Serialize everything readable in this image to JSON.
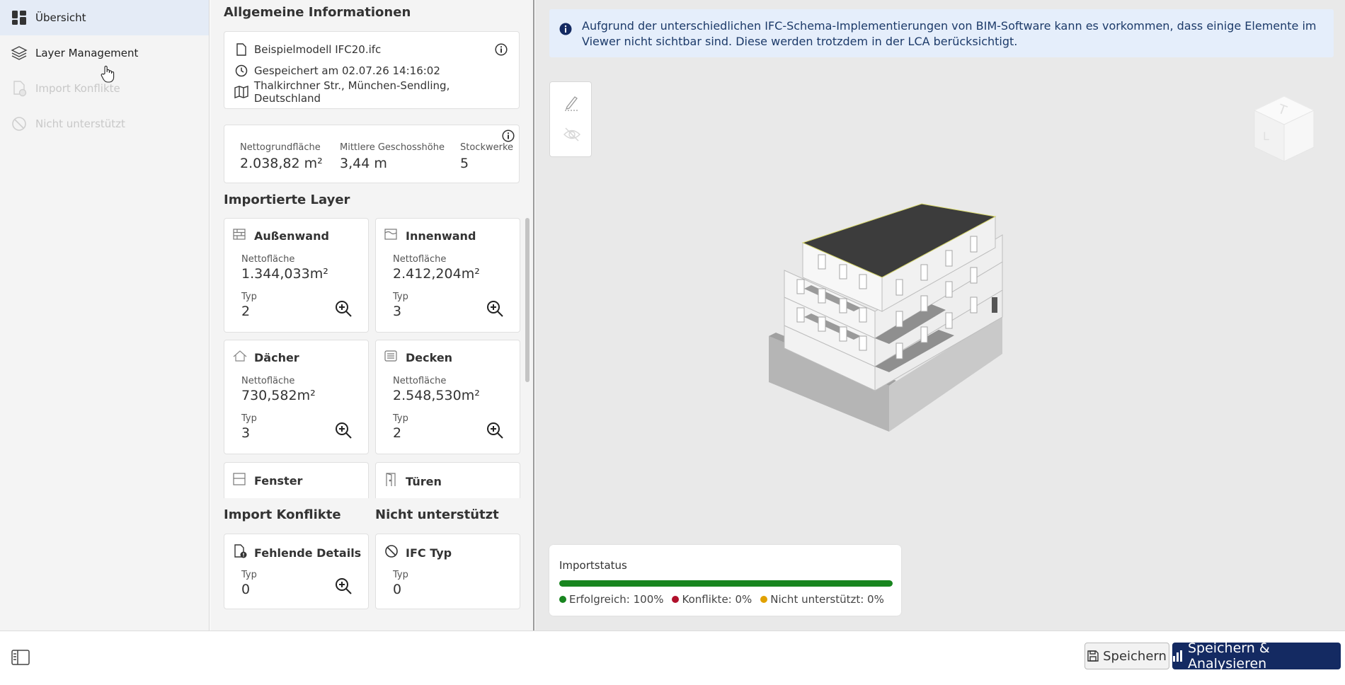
{
  "sidebar": {
    "items": [
      {
        "label": "Übersicht",
        "icon": "dashboard-icon",
        "state": "active"
      },
      {
        "label": "Layer Management",
        "icon": "layers-icon",
        "state": "normal"
      },
      {
        "label": "Import Konflikte",
        "icon": "file-conflict-icon",
        "state": "disabled"
      },
      {
        "label": "Nicht unterstützt",
        "icon": "ban-icon",
        "state": "disabled"
      }
    ]
  },
  "general": {
    "title": "Allgemeine Informationen",
    "file": "Beispielmodell IFC20.ifc",
    "saved": "Gespeichert am 02.07.26 14:16:02",
    "address": "Thalkirchner Str., München-Sendling, Deutschland"
  },
  "stats": [
    {
      "label": "Nettogrundfläche",
      "value": "2.038,82 m²"
    },
    {
      "label": "Mittlere Geschosshöhe",
      "value": "3,44 m"
    },
    {
      "label": "Stockwerke",
      "value": "5"
    }
  ],
  "layers": {
    "title": "Importierte Layer",
    "area_label": "Nettofläche",
    "type_label": "Typ",
    "items": [
      {
        "name": "Außenwand",
        "area": "1.344,033m²",
        "type": "2",
        "icon": "brick-wall-icon"
      },
      {
        "name": "Innenwand",
        "area": "2.412,204m²",
        "type": "3",
        "icon": "inner-wall-icon"
      },
      {
        "name": "Dächer",
        "area": "730,582m²",
        "type": "3",
        "icon": "roof-icon"
      },
      {
        "name": "Decken",
        "area": "2.548,530m²",
        "type": "2",
        "icon": "slab-icon"
      },
      {
        "name": "Fenster",
        "icon": "window-icon"
      },
      {
        "name": "Türen",
        "icon": "door-icon"
      }
    ]
  },
  "conflicts": {
    "title": "Import Konflikte",
    "card_name": "Fehlende Details",
    "type_label": "Typ",
    "type_value": "0"
  },
  "unsupported": {
    "title": "Nicht unterstützt",
    "card_name": "IFC Typ",
    "type_label": "Typ",
    "type_value": "0"
  },
  "viewer": {
    "banner": "Aufgrund der unterschiedlichen IFC-Schema-Implementierungen von BIM-Software kann es vorkommen, dass einige Elemente im Viewer nicht sichtbar sind. Diese werden trotzdem in der LCA berücksichtigt."
  },
  "import_status": {
    "title": "Importstatus",
    "progress_fraction": 1.0,
    "legend": [
      {
        "label": "Erfolgreich: 100%",
        "color": "#18851f"
      },
      {
        "label": "Konflikte: 0%",
        "color": "#b0102b"
      },
      {
        "label": "Nicht unterstützt: 0%",
        "color": "#e1a100"
      }
    ]
  },
  "footer": {
    "save_label": "Speichern",
    "analyse_label": "Speichern & Analysieren"
  },
  "colors": {
    "accent_dark": "#142a62",
    "active_bg": "#e4ebf6",
    "banner_bg": "#e5eefb",
    "success": "#18851f"
  }
}
